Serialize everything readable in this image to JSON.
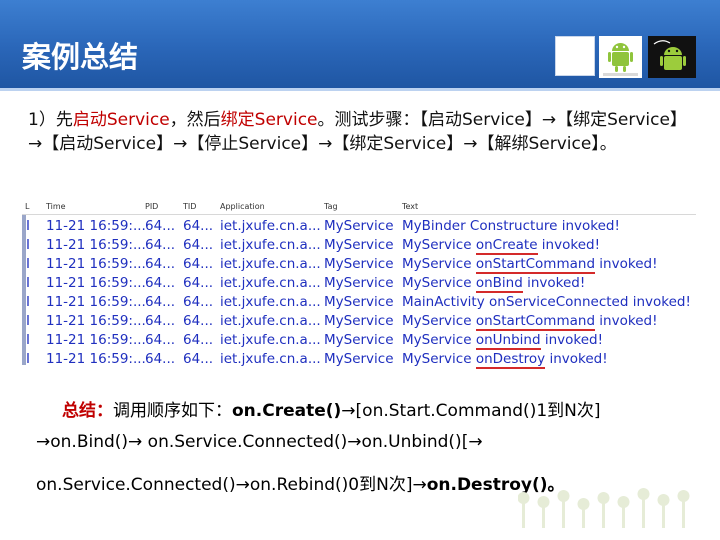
{
  "header": {
    "title": "案例总结"
  },
  "intro": {
    "p1": "1）先",
    "p2": "启动Service",
    "p3": "，然后",
    "p4": "绑定Service",
    "p5": "。测试步骤：【启动Service】→【绑定Service】→【启动Service】→【停止Service】→【绑定Service】→【解绑Service】。"
  },
  "log": {
    "headers": [
      "L",
      "Time",
      "PID",
      "TID",
      "Application",
      "Tag",
      "Text"
    ],
    "rows": [
      {
        "level": "I",
        "time": "11-21 16:59:...",
        "pid": "64...",
        "tid": "64...",
        "app": "iet.jxufe.cn.a...",
        "tag": "MyService",
        "pre": "My",
        "mid": "Binder Constructure invoked!",
        "post": "",
        "underline": false
      },
      {
        "level": "I",
        "time": "11-21 16:59:...",
        "pid": "64...",
        "tid": "64...",
        "app": "iet.jxufe.cn.a...",
        "tag": "MyService",
        "pre": "MyService ",
        "mid": "onCreate",
        "post": " invoked!",
        "underline": true
      },
      {
        "level": "I",
        "time": "11-21 16:59:...",
        "pid": "64...",
        "tid": "64...",
        "app": "iet.jxufe.cn.a...",
        "tag": "MyService",
        "pre": "MyService ",
        "mid": "onStartCommand",
        "post": " invoked!",
        "underline": true
      },
      {
        "level": "I",
        "time": "11-21 16:59:...",
        "pid": "64...",
        "tid": "64...",
        "app": "iet.jxufe.cn.a...",
        "tag": "MyService",
        "pre": "MyService ",
        "mid": "onBind",
        "post": " invoked!",
        "underline": true
      },
      {
        "level": "I",
        "time": "11-21 16:59:...",
        "pid": "64...",
        "tid": "64...",
        "app": "iet.jxufe.cn.a...",
        "tag": "MyService",
        "pre": "MainActivity ",
        "mid": "onServiceConnected invoked!",
        "post": "",
        "underline": false
      },
      {
        "level": "I",
        "time": "11-21 16:59:...",
        "pid": "64...",
        "tid": "64...",
        "app": "iet.jxufe.cn.a...",
        "tag": "MyService",
        "pre": "MyService ",
        "mid": "onStartCommand",
        "post": " invoked!",
        "underline": true
      },
      {
        "level": "I",
        "time": "11-21 16:59:...",
        "pid": "64...",
        "tid": "64...",
        "app": "iet.jxufe.cn.a...",
        "tag": "MyService",
        "pre": "MyService ",
        "mid": "onUnbind",
        "post": " invoked!",
        "underline": true
      },
      {
        "level": "I",
        "time": "11-21 16:59:...",
        "pid": "64...",
        "tid": "64...",
        "app": "iet.jxufe.cn.a...",
        "tag": "MyService",
        "pre": "MyService ",
        "mid": "onDestroy",
        "post": " invoked!",
        "underline": true
      }
    ]
  },
  "summary": {
    "label": "总结：",
    "l1a": "调用顺序如下：",
    "l1b": "on.Create()",
    "l1c": "→[on.Start.Command()1到N次]",
    "l2": "→on.Bind()→ on.Service.Connected()→on.Unbind()[→",
    "l3a": "on.Service.Connected()→on.Rebind()0到N次]→",
    "l3b": "on.Destroy()",
    "l3c": "。"
  },
  "colors": {
    "header": "#2a66b8",
    "accent_red": "#c00000",
    "log_text": "#1f2fbf"
  },
  "icons": [
    "android-icon",
    "android-robot-icon"
  ]
}
